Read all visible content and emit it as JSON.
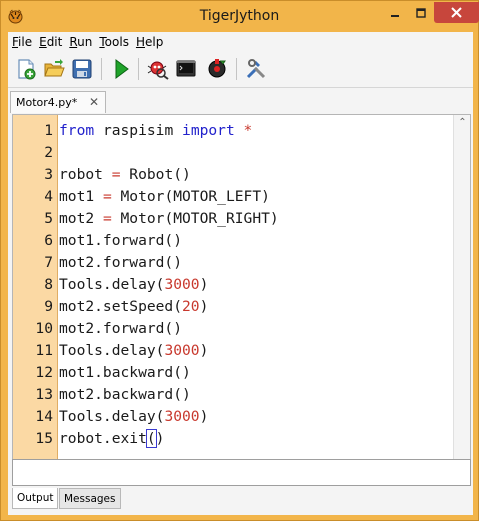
{
  "window": {
    "title": "TigerJython"
  },
  "menu": {
    "items": [
      {
        "label": "File",
        "mnemonic": "F",
        "rest": "ile"
      },
      {
        "label": "Edit",
        "mnemonic": "E",
        "rest": "dit"
      },
      {
        "label": "Run",
        "mnemonic": "R",
        "rest": "un"
      },
      {
        "label": "Tools",
        "mnemonic": "T",
        "rest": "ools"
      },
      {
        "label": "Help",
        "mnemonic": "H",
        "rest": "elp"
      }
    ]
  },
  "toolbar": {
    "buttons": [
      {
        "icon": "new-file-icon"
      },
      {
        "icon": "open-folder-icon"
      },
      {
        "icon": "save-icon"
      },
      {
        "icon": "run-icon"
      },
      {
        "icon": "debug-icon"
      },
      {
        "icon": "console-icon"
      },
      {
        "icon": "robot-icon"
      },
      {
        "icon": "settings-tools-icon"
      }
    ]
  },
  "editor": {
    "tab_name": "Motor4.py*",
    "tab_close": "✕",
    "lines": [
      {
        "no": "1",
        "tokens": [
          {
            "t": "from",
            "c": "kw"
          },
          {
            "t": " raspisim ",
            "c": ""
          },
          {
            "t": "import",
            "c": "kw"
          },
          {
            "t": " ",
            "c": ""
          },
          {
            "t": "*",
            "c": "op"
          }
        ]
      },
      {
        "no": "2",
        "tokens": []
      },
      {
        "no": "3",
        "tokens": [
          {
            "t": "robot ",
            "c": ""
          },
          {
            "t": "=",
            "c": "op"
          },
          {
            "t": " Robot()",
            "c": ""
          }
        ]
      },
      {
        "no": "4",
        "tokens": [
          {
            "t": "mot1 ",
            "c": ""
          },
          {
            "t": "=",
            "c": "op"
          },
          {
            "t": " Motor(MOTOR_LEFT)",
            "c": ""
          }
        ]
      },
      {
        "no": "5",
        "tokens": [
          {
            "t": "mot2 ",
            "c": ""
          },
          {
            "t": "=",
            "c": "op"
          },
          {
            "t": " Motor(MOTOR_RIGHT)",
            "c": ""
          }
        ]
      },
      {
        "no": "6",
        "tokens": [
          {
            "t": "mot1.forward()",
            "c": ""
          }
        ]
      },
      {
        "no": "7",
        "tokens": [
          {
            "t": "mot2.forward()",
            "c": ""
          }
        ]
      },
      {
        "no": "8",
        "tokens": [
          {
            "t": "Tools.delay(",
            "c": ""
          },
          {
            "t": "3000",
            "c": "num"
          },
          {
            "t": ")",
            "c": ""
          }
        ]
      },
      {
        "no": "9",
        "tokens": [
          {
            "t": "mot2.setSpeed(",
            "c": ""
          },
          {
            "t": "20",
            "c": "num"
          },
          {
            "t": ")",
            "c": ""
          }
        ]
      },
      {
        "no": "10",
        "tokens": [
          {
            "t": "mot2.forward()",
            "c": ""
          }
        ]
      },
      {
        "no": "11",
        "tokens": [
          {
            "t": "Tools.delay(",
            "c": ""
          },
          {
            "t": "3000",
            "c": "num"
          },
          {
            "t": ")",
            "c": ""
          }
        ]
      },
      {
        "no": "12",
        "tokens": [
          {
            "t": "mot1.backward()",
            "c": ""
          }
        ]
      },
      {
        "no": "13",
        "tokens": [
          {
            "t": "mot2.backward()",
            "c": ""
          }
        ]
      },
      {
        "no": "14",
        "tokens": [
          {
            "t": "Tools.delay(",
            "c": ""
          },
          {
            "t": "3000",
            "c": "num"
          },
          {
            "t": ")",
            "c": ""
          }
        ]
      },
      {
        "no": "15",
        "tokens": [
          {
            "t": "robot.exit",
            "c": ""
          },
          {
            "t": "(",
            "c": "hl"
          },
          {
            "t": ")",
            "c": ""
          }
        ]
      }
    ]
  },
  "output_panel": {
    "text": "",
    "tabs": [
      {
        "label": "Output",
        "active": true
      },
      {
        "label": "Messages",
        "active": false
      }
    ]
  },
  "colors": {
    "frame": "#f2b54a",
    "gutter": "#fbd9a4",
    "keyword": "#2222cc",
    "number": "#c8382d",
    "close_button": "#c7463c"
  }
}
